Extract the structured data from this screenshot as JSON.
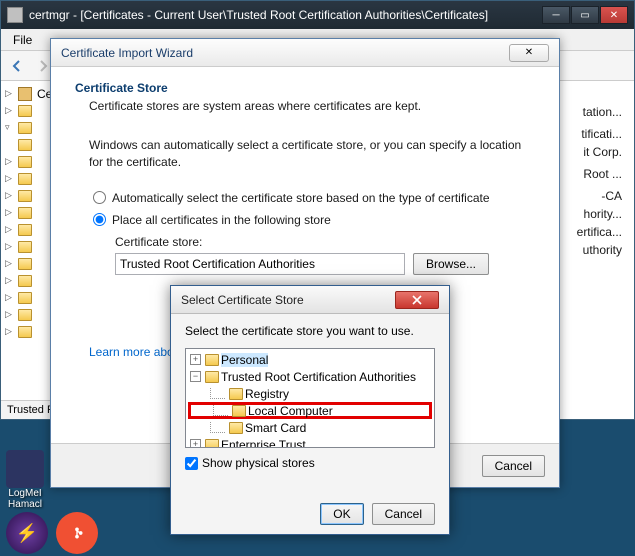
{
  "main": {
    "title": "certmgr - [Certificates - Current User\\Trusted Root Certification Authorities\\Certificates]",
    "menu": {
      "file": "File"
    },
    "tree": {
      "root_short": "Cert"
    },
    "right_items": [
      "tation...",
      "",
      "tificati...",
      "it Corp.",
      "",
      "Root ...",
      "",
      "-CA",
      "hority...",
      "ertifica...",
      "uthority"
    ],
    "status": "Trusted F"
  },
  "wizard": {
    "title": "Certificate Import Wizard",
    "heading": "Certificate Store",
    "sub": "Certificate stores are system areas where certificates are kept.",
    "p": "Windows can automatically select a certificate store, or you can specify a location for the certificate.",
    "radio_auto": "Automatically select the certificate store based on the type of certificate",
    "radio_place": "Place all certificates in the following store",
    "store_label": "Certificate store:",
    "store_value": "Trusted Root Certification Authorities",
    "browse": "Browse...",
    "learn_more": "Learn more about",
    "cancel": "Cancel"
  },
  "selstore": {
    "title": "Select Certificate Store",
    "p": "Select the certificate store you want to use.",
    "items": {
      "personal": "Personal",
      "trusted_root": "Trusted Root Certification Authorities",
      "registry": "Registry",
      "local_computer": "Local Computer",
      "smart_card": "Smart Card",
      "enterprise_trust": "Enterprise Trust"
    },
    "show_physical": "Show physical stores",
    "ok": "OK",
    "cancel": "Cancel"
  },
  "taskbar": {
    "logmein": "LogMeI",
    "hamachi": "Hamacl"
  }
}
